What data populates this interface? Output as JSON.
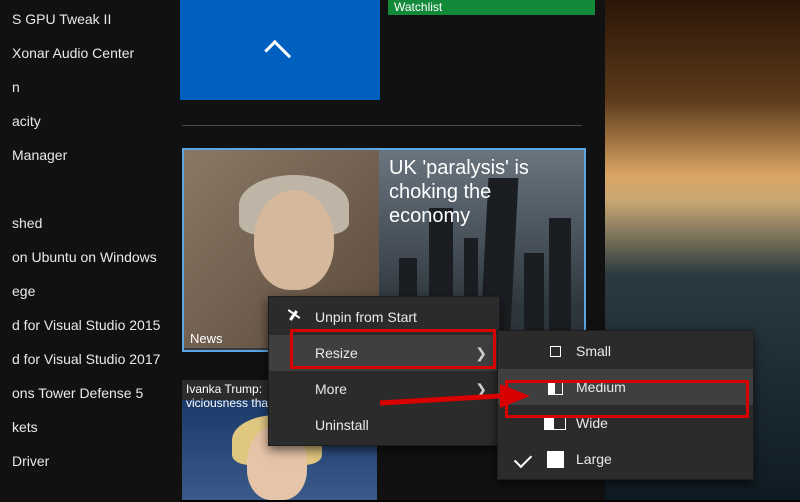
{
  "sidebar": {
    "apps": [
      "S GPU Tweak II",
      " Xonar Audio Center",
      "n",
      "acity",
      " Manager",
      "",
      "shed",
      " on Ubuntu on Windows",
      "ege",
      "d for Visual Studio 2015",
      "d for Visual Studio 2017",
      "ons Tower Defense 5",
      "kets",
      "Driver"
    ]
  },
  "tiles": {
    "green_label": "Watchlist",
    "news_headline": "UK 'paralysis' is choking the economy",
    "news_label": "News",
    "ivanka_caption": "Ivanka Trump:\nviciousness tha"
  },
  "context_menu": {
    "unpin": "Unpin from Start",
    "resize": "Resize",
    "more": "More",
    "uninstall": "Uninstall"
  },
  "resize_menu": {
    "small": "Small",
    "medium": "Medium",
    "wide": "Wide",
    "large": "Large"
  }
}
